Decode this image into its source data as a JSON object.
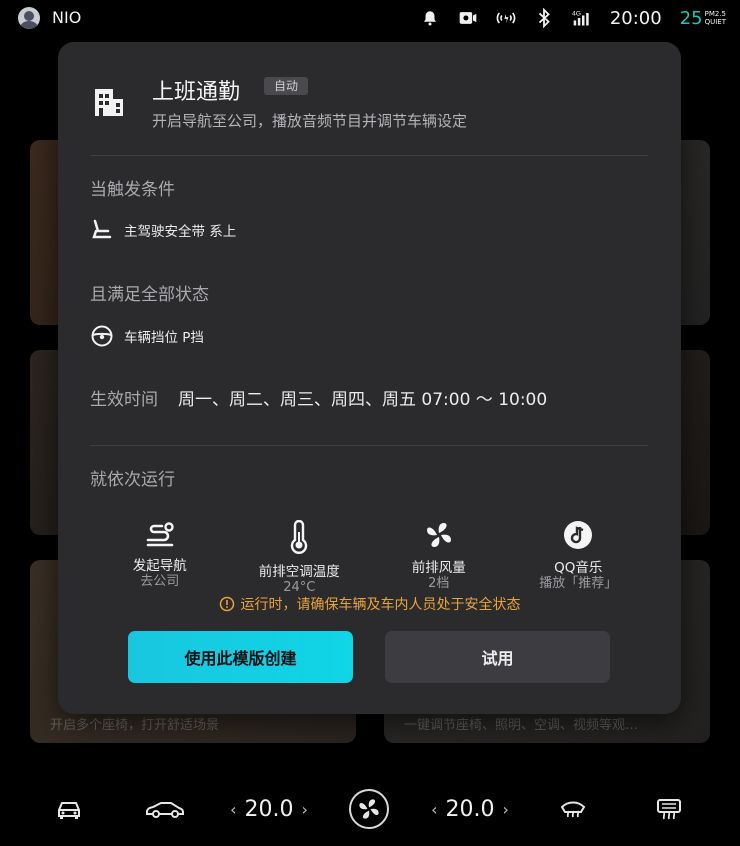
{
  "status_bar": {
    "brand": "NIO",
    "time": "20:00",
    "network": "4G",
    "aqi_value": "25",
    "aqi_label_top": "PM2.5",
    "aqi_label_bottom": "QUIET",
    "aqi_color": "#18c9b7"
  },
  "background_cards": [
    {
      "caption": ""
    },
    {
      "caption": ""
    },
    {
      "caption": ""
    },
    {
      "caption": ""
    },
    {
      "caption": "开启多个座椅，打开舒适场景"
    },
    {
      "caption": "一键调节座椅、照明、空调、视频等观…"
    }
  ],
  "dialog": {
    "icon": "office-building-icon",
    "title": "上班通勤",
    "tag": "自动",
    "subtitle": "开启导航至公司，播放音频节目并调节车辆设定",
    "trigger_label": "当触发条件",
    "trigger": {
      "icon": "seatbelt-icon",
      "text": "主驾驶安全带 系上"
    },
    "state_label": "且满足全部状态",
    "state": {
      "icon": "steering-wheel-icon",
      "text": "车辆挡位 P挡"
    },
    "time_label": "生效时间",
    "time_value": "周一、周二、周三、周四、周五 07:00 ～ 10:00",
    "run_label": "就依次运行",
    "actions": [
      {
        "icon": "navigation-route-icon",
        "name": "发起导航",
        "detail": "去公司"
      },
      {
        "icon": "thermometer-icon",
        "name": "前排空调温度",
        "detail": "24°C"
      },
      {
        "icon": "fan-icon",
        "name": "前排风量",
        "detail": "2档"
      },
      {
        "icon": "qq-music-icon",
        "name": "QQ音乐",
        "detail": "播放「推荐」"
      }
    ],
    "warning": "运行时，请确保车辆及车内人员处于安全状态",
    "warning_color": "#e8a33a",
    "primary_button": "使用此模版创建",
    "secondary_button": "试用",
    "accent_color": "#19c6e0"
  },
  "dock": {
    "left_temp": "20.0",
    "right_temp": "20.0",
    "left_arrow_prev": "‹",
    "left_arrow_next": "›",
    "right_arrow_prev": "‹",
    "right_arrow_next": "›"
  }
}
